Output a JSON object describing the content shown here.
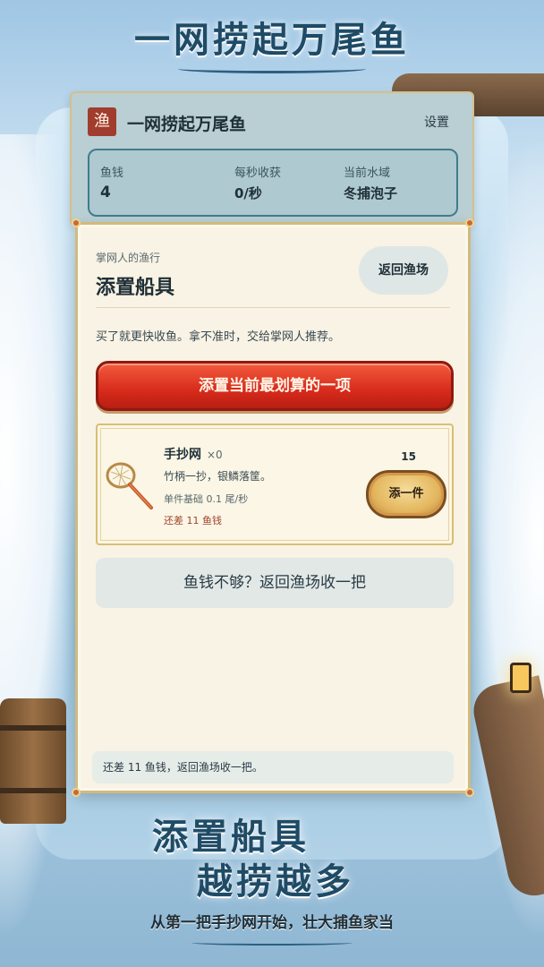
{
  "poster": {
    "title": "一网捞起万尾鱼",
    "promo_line1": "添置船具",
    "promo_line2": "越捞越多",
    "promo_tagline": "从第一把手抄网开始，壮大捕鱼家当"
  },
  "header": {
    "seal_char": "渔",
    "app_name": "一网捞起万尾鱼",
    "settings_label": "设置"
  },
  "stats": {
    "money_label": "鱼钱",
    "money_value": "4",
    "rate_label": "每秒收获",
    "rate_value": "0/秒",
    "water_label": "当前水域",
    "water_value": "冬捕泡子"
  },
  "shop": {
    "subtitle": "掌网人的渔行",
    "title": "添置船具",
    "back_label": "返回渔场",
    "description": "买了就更快收鱼。拿不准时，交给掌网人推荐。",
    "best_button": "添置当前最划算的一项",
    "items": [
      {
        "name": "手抄网",
        "count": "×0",
        "flavor": "竹柄一抄，银鳞落筐。",
        "rate": "单件基础 0.1 尾/秒",
        "need": "还差 11 鱼钱",
        "price": "15",
        "buy_label": "添一件",
        "icon": "hand-net-icon"
      }
    ],
    "not_enough_button": "鱼钱不够？返回渔场收一把",
    "footer_note": "还差 11 鱼钱，返回渔场收一把。"
  },
  "colors": {
    "accent_red": "#d82b1c",
    "panel_bg": "#f8f3e4",
    "header_bg": "#b9cfd3",
    "gold_border": "#d2ba7c",
    "title_blue": "#1f4b66"
  }
}
